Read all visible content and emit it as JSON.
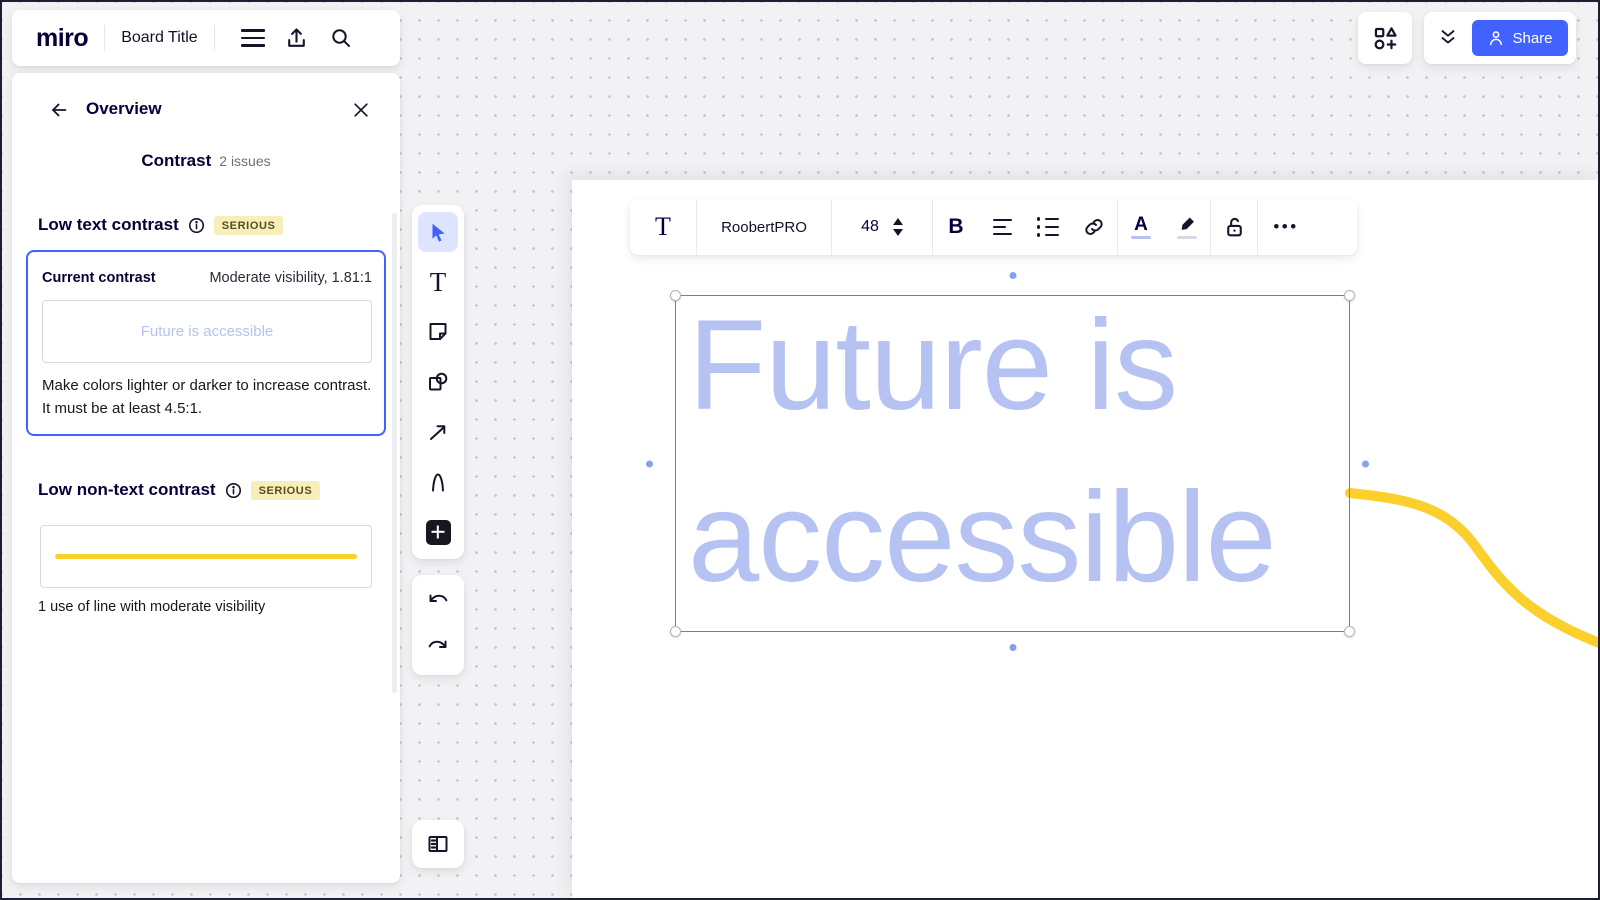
{
  "header": {
    "logo": "miro",
    "board_title": "Board Title"
  },
  "top_right": {
    "share_label": "Share"
  },
  "panel": {
    "title": "Overview",
    "back_glyph": "←",
    "contrast": {
      "title": "Contrast",
      "count": "2 issues"
    },
    "low_text": {
      "title": "Low text contrast",
      "severity": "SERIOUS",
      "current_label": "Current contrast",
      "visibility": "Moderate visibility, 1.81:1",
      "preview_text": "Future is accessible",
      "description": "Make colors lighter or darker to increase contrast. It must be at least 4.5:1."
    },
    "low_line": {
      "title": "Low non-text contrast",
      "severity": "SERIOUS",
      "caption": "1 use of line with moderate visibility"
    }
  },
  "tools": {
    "text_glyph": "T"
  },
  "text_toolbar": {
    "text_tool_glyph": "T",
    "font_name": "RoobertPRO",
    "font_size": "48",
    "bold_glyph": "B",
    "color_glyph": "A",
    "more_glyph": "•••"
  },
  "canvas": {
    "lines": [
      "Future is",
      "accessible"
    ]
  },
  "icons": {
    "hamburger-icon": "three horizontal bars",
    "export-icon": "arrow up from tray",
    "search-icon": "magnifier",
    "widgets-icon": "square triangle circle plus",
    "collapse-icon": "double chevron down",
    "person-icon": "user silhouette",
    "close-icon": "X",
    "info-icon": "i in circle",
    "cursor-icon": "select arrow",
    "sticky-note-icon": "note with folded corner",
    "shapes-icon": "square and circle",
    "connector-icon": "diagonal arrow",
    "pen-icon": "pen stroke",
    "add-icon": "plus in dark square",
    "undo-icon": "curved arrow left",
    "redo-icon": "curved arrow right",
    "frames-icon": "panel with list",
    "link-icon": "chain link",
    "lock-icon": "open padlock"
  },
  "colors": {
    "accent": "#4262ff",
    "selection": "#4a82f0",
    "canvas_text": "#b6c2f2",
    "yellow": "#fbd02c",
    "badge_bg": "#f7eeba",
    "badge_text": "#54501d",
    "dark": "#050038"
  }
}
